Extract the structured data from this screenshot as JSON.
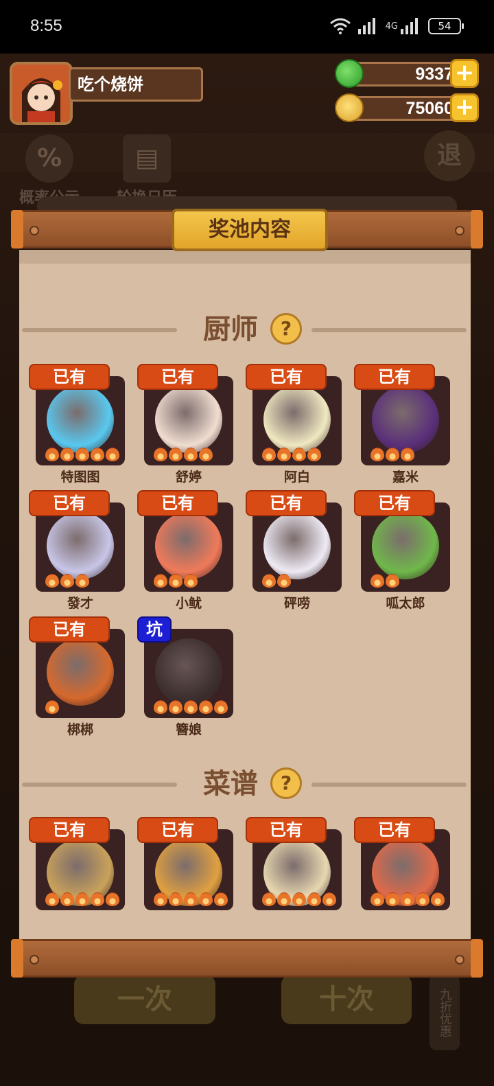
{
  "status_bar": {
    "time": "8:55",
    "network": "4G",
    "battery": "54"
  },
  "player": {
    "name": "吃个烧饼"
  },
  "currencies": {
    "gems": {
      "value": "9337",
      "color": "#3fb83a"
    },
    "coins": {
      "value": "75060",
      "color": "#f2c84b"
    }
  },
  "background": {
    "tools": [
      {
        "label": "概率公示",
        "icon": "%"
      },
      {
        "label": "轮换日历",
        "icon": "▤"
      }
    ],
    "exit_label": "退",
    "bottom_buttons": [
      "一次",
      "十次"
    ],
    "side_label": "九折优惠"
  },
  "modal": {
    "title": "奖池内容",
    "chefs": {
      "title": "厨师",
      "help_icon": "?",
      "items": [
        {
          "name": "特图图",
          "badge": "已有",
          "badge_type": "owned",
          "stars": 5,
          "color": "#59c8ef"
        },
        {
          "name": "舒婷",
          "badge": "已有",
          "badge_type": "owned",
          "stars": 4,
          "color": "#f1ddd0"
        },
        {
          "name": "阿白",
          "badge": "已有",
          "badge_type": "owned",
          "stars": 4,
          "color": "#f0e8c0"
        },
        {
          "name": "嘉米",
          "badge": "已有",
          "badge_type": "owned",
          "stars": 3,
          "color": "#5a2f7a"
        },
        {
          "name": "發才",
          "badge": "已有",
          "badge_type": "owned",
          "stars": 3,
          "color": "#c8c6e8"
        },
        {
          "name": "小鱿",
          "badge": "已有",
          "badge_type": "owned",
          "stars": 3,
          "color": "#f07a5a"
        },
        {
          "name": "砰唠",
          "badge": "已有",
          "badge_type": "owned",
          "stars": 2,
          "color": "#eeeaf4"
        },
        {
          "name": "呱太郎",
          "badge": "已有",
          "badge_type": "owned",
          "stars": 2,
          "color": "#6fb84a"
        },
        {
          "name": "梆梆",
          "badge": "已有",
          "badge_type": "owned",
          "stars": 1,
          "color": "#d6692d"
        },
        {
          "name": "簪娘",
          "badge": "坑",
          "badge_type": "pit",
          "stars": 5,
          "color": "#3f3535"
        }
      ]
    },
    "recipes": {
      "title": "菜谱",
      "help_icon": "?",
      "items": [
        {
          "badge": "已有",
          "stars": 5,
          "color": "#c9a25a"
        },
        {
          "badge": "已有",
          "stars": 5,
          "color": "#e0a040"
        },
        {
          "badge": "已有",
          "stars": 5,
          "color": "#e8d8b0"
        },
        {
          "badge": "已有",
          "stars": 5,
          "color": "#e06a4a"
        }
      ]
    }
  }
}
